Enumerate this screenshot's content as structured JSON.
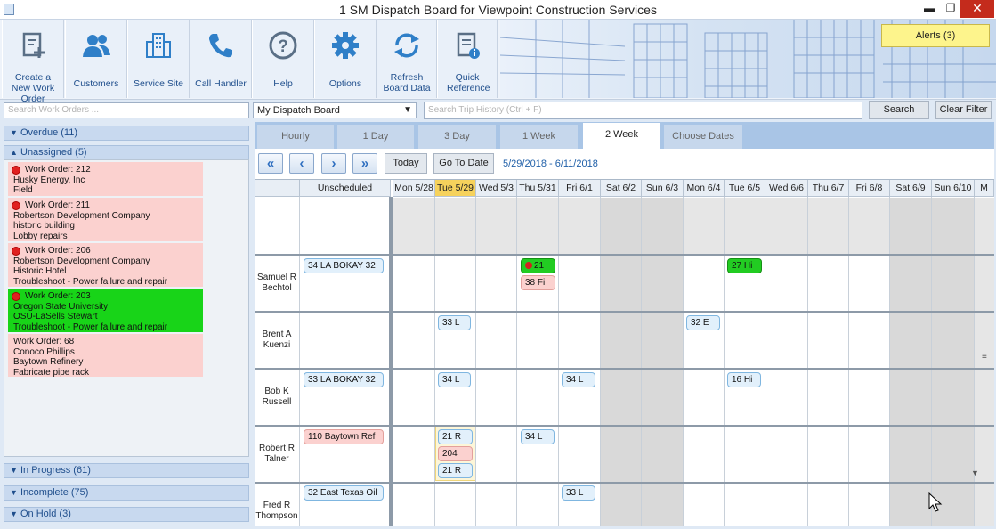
{
  "window": {
    "title": "1 SM Dispatch Board for Viewpoint Construction Services",
    "minimize": "▬",
    "maximize": "❐",
    "close": "✕"
  },
  "ribbon": {
    "buttons": [
      {
        "label": "Create a New Work Order",
        "icon": "new-work-order-icon"
      },
      {
        "label": "Customers",
        "icon": "customers-icon"
      },
      {
        "label": "Service Site",
        "icon": "building-icon"
      },
      {
        "label": "Call Handler",
        "icon": "phone-icon"
      },
      {
        "label": "Help",
        "icon": "help-icon"
      },
      {
        "label": "Options",
        "icon": "gear-icon"
      },
      {
        "label": "Refresh Board Data",
        "icon": "refresh-icon"
      },
      {
        "label": "Quick Reference",
        "icon": "quick-reference-icon"
      }
    ],
    "alerts": "Alerts (3)"
  },
  "toolbar": {
    "search_work_orders_placeholder": "Search Work Orders ...",
    "board_selected": "My Dispatch Board",
    "search_trip_placeholder": "Search Trip History (Ctrl + F)",
    "search_label": "Search",
    "clear_filter_label": "Clear Filter"
  },
  "groups": {
    "overdue": "Overdue (11)",
    "unassigned": "Unassigned (5)",
    "in_progress": "In Progress (61)",
    "incomplete": "Incomplete (75)",
    "on_hold": "On Hold (3)"
  },
  "work_orders": [
    {
      "title": "Work Order: 212",
      "l1": "Husky Energy, Inc",
      "l2": "Field",
      "l3": ""
    },
    {
      "title": "Work Order: 211",
      "l1": "Robertson Development Company",
      "l2": "historic building",
      "l3": "Lobby repairs"
    },
    {
      "title": "Work Order: 206",
      "l1": "Robertson Development Company",
      "l2": "Historic Hotel",
      "l3": "Troubleshoot - Power failure and repair"
    },
    {
      "title": "Work Order: 203",
      "l1": "Oregon State University",
      "l2": "OSU-LaSells Stewart",
      "l3": "Troubleshoot - Power failure and repair"
    },
    {
      "title": "Work Order: 68",
      "l1": "Conoco Phillips",
      "l2": "Baytown Refinery",
      "l3": "Fabricate pipe rack"
    }
  ],
  "tabs": [
    "Hourly",
    "1 Day",
    "3 Day",
    "1 Week",
    "2 Week",
    "Choose Dates"
  ],
  "nav": {
    "first": "«",
    "prev": "‹",
    "next": "›",
    "last": "»",
    "today": "Today",
    "goto": "Go To Date",
    "range": "5/29/2018 - 6/11/2018"
  },
  "schedule": {
    "unscheduled_header": "Unscheduled",
    "days": [
      "Mon 5/28",
      "Tue 5/29",
      "Wed 5/3",
      "Thu 5/31",
      "Fri 6/1",
      "Sat 6/2",
      "Sun 6/3",
      "Mon 6/4",
      "Tue 6/5",
      "Wed 6/6",
      "Thu 6/7",
      "Fri 6/8",
      "Sat 6/9",
      "Sun 6/10",
      "M"
    ],
    "techs": [
      {
        "first": "Samuel R",
        "last": "Bechtol"
      },
      {
        "first": "Brent A",
        "last": "Kuenzi"
      },
      {
        "first": "Bob K",
        "last": "Russell"
      },
      {
        "first": "Robert R",
        "last": "Talner"
      },
      {
        "first": "Fred R",
        "last": "Thompson"
      }
    ],
    "chips": {
      "c1": "34 LA BOKAY 32",
      "c2": "21",
      "c3": "38 Fi",
      "c4": "27 Hi",
      "c5": "33 L",
      "c6": "32 E",
      "c7": "33 LA BOKAY 32",
      "c8": "34 L",
      "c9": "34 L",
      "c10": "16 Hi",
      "c11": "110 Baytown Ref",
      "c12": "21 R",
      "c13": "204",
      "c14": "21 R",
      "c15": "34 L",
      "c16": "32 East Texas Oil",
      "c17": "33 L"
    }
  }
}
